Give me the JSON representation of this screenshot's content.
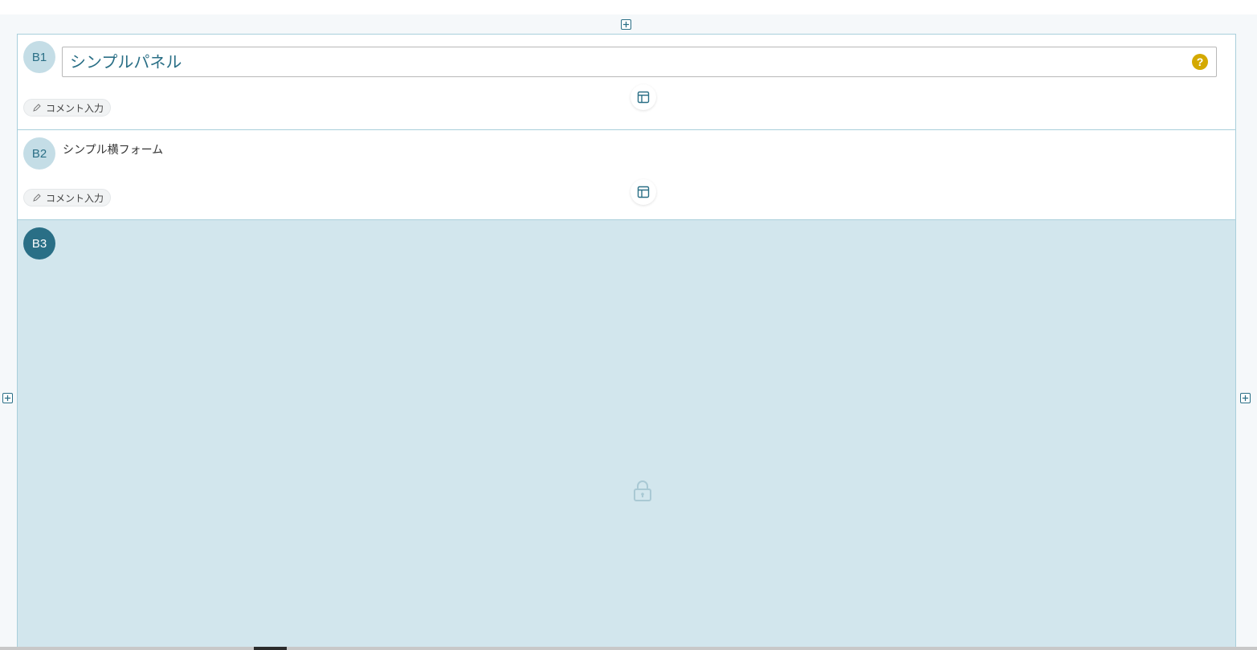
{
  "colors": {
    "accent": "#2a6f86",
    "badge_inactive_bg": "#c4dde6",
    "selected_block_bg": "#d2e6ed",
    "help_icon": "#d4a900"
  },
  "blocks": [
    {
      "id_badge": "B1",
      "title_value": "シンプルパネル",
      "help_icon": "question-circle-icon",
      "comment_label": "コメント入力"
    },
    {
      "id_badge": "B2",
      "form_label": "シンプル横フォーム",
      "comment_label": "コメント入力"
    },
    {
      "id_badge": "B3",
      "state_icon": "lock-icon"
    }
  ]
}
